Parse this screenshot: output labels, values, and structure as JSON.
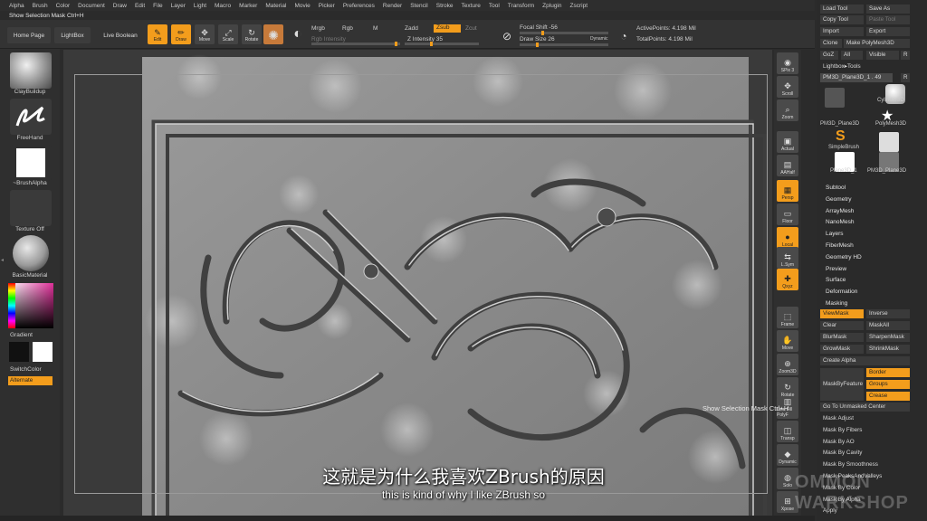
{
  "menu": [
    "Alpha",
    "Brush",
    "Color",
    "Document",
    "Draw",
    "Edit",
    "File",
    "Layer",
    "Light",
    "Macro",
    "Marker",
    "Material",
    "Movie",
    "Picker",
    "Preferences",
    "Render",
    "Stencil",
    "Stroke",
    "Texture",
    "Tool",
    "Transform",
    "Zplugin",
    "Zscript"
  ],
  "notice": "Show Selection Mask Ctrl+H",
  "toolbar": {
    "home_page": "Home Page",
    "lightbox": "LightBox",
    "live_boolean": "Live Boolean",
    "edit": "Edit",
    "draw": "Draw",
    "move": "Move",
    "scale": "Scale",
    "rotate": "Rotate",
    "mrgb": "Mrgb",
    "rgb": "Rgb",
    "m": "M",
    "rgb_intensity": "Rgb Intensity",
    "zadd": "Zadd",
    "zsub": "Zsub",
    "zcut": "Zcut",
    "z_intensity": "Z Intensity 35",
    "focal_shift": "Focal Shift -56",
    "draw_size": "Draw Size 26",
    "dynamic": "Dynamic",
    "active_points": "ActivePoints: 4.198 Mil",
    "total_points": "TotalPoints: 4.198 Mil"
  },
  "left_shelf": {
    "brush": "ClayBuildup",
    "stroke": "FreeHand",
    "alpha": "~BrushAlpha",
    "texture": "Texture Off",
    "material": "BasicMaterial",
    "gradient": "Gradient",
    "switch_color": "SwitchColor",
    "alternate": "Alternate"
  },
  "right_icons": [
    {
      "name": "spix",
      "label": "SPix 3",
      "glyph": "◉"
    },
    {
      "name": "scroll",
      "label": "Scroll",
      "glyph": "✥"
    },
    {
      "name": "zoom",
      "label": "Zoom",
      "glyph": "⌕"
    },
    {
      "name": "actual",
      "label": "Actual",
      "glyph": "▣"
    },
    {
      "name": "aahalf",
      "label": "AAHalf",
      "glyph": "▤"
    },
    {
      "name": "persp",
      "label": "Persp",
      "glyph": "▦"
    },
    {
      "name": "floor",
      "label": "Floor",
      "glyph": "▭"
    },
    {
      "name": "local",
      "label": "Local",
      "glyph": "●"
    },
    {
      "name": "lsym",
      "label": "L.Sym",
      "glyph": "⇆"
    },
    {
      "name": "qxyz",
      "label": "Qxyz",
      "glyph": "✚"
    },
    {
      "name": "frame",
      "label": "Frame",
      "glyph": "⬚"
    },
    {
      "name": "move",
      "label": "Move",
      "glyph": "✋"
    },
    {
      "name": "zoom3d",
      "label": "Zoom3D",
      "glyph": "⊕"
    },
    {
      "name": "rotate",
      "label": "Rotate",
      "glyph": "↻"
    },
    {
      "name": "linefill",
      "label": "Line Fill PolyF",
      "glyph": "▥"
    },
    {
      "name": "transp",
      "label": "Transp",
      "glyph": "◫"
    },
    {
      "name": "dynamic",
      "label": "Dynamic",
      "glyph": "◆"
    },
    {
      "name": "solo",
      "label": "Solo",
      "glyph": "◍"
    },
    {
      "name": "xpose",
      "label": "Xpose",
      "glyph": "⊞"
    }
  ],
  "panel": {
    "load_tool": "Load Tool",
    "save_as": "Save As",
    "copy_tool": "Copy Tool",
    "paste_tool": "Paste Tool",
    "import": "Import",
    "export": "Export",
    "clone": "Clone",
    "make_polymesh": "Make PolyMesh3D",
    "goz": "GoZ",
    "all": "All",
    "visible": "Visible",
    "r": "R",
    "lightbox_tools": "Lightbox▸Tools",
    "current_tool": "PM3D_Plane3D_1",
    "current_tool_value": "49",
    "thumbs": [
      "PM3D_Plane3D",
      "Cylinder3D",
      "SimpleBrush",
      "PolyMesh3D",
      "Plane3D_1",
      "PM3D_Plane3D"
    ],
    "subpalettes": [
      "Subtool",
      "Geometry",
      "ArrayMesh",
      "NanoMesh",
      "Layers",
      "FiberMesh",
      "Geometry HD",
      "Preview",
      "Surface",
      "Deformation",
      "Masking"
    ],
    "view_mask": "ViewMask",
    "inverse": "Inverse",
    "clear": "Clear",
    "mask_all": "MaskAll",
    "blur_mask": "BlurMask",
    "sharpen_mask": "SharpenMask",
    "grow_mask": "GrowMask",
    "shrink_mask": "ShrinkMask",
    "create_alpha": "Create Alpha",
    "mask_by_feature": "MaskByFeature",
    "border": "Border",
    "groups": "Groups",
    "crease": "Crease",
    "go_to_unmasked": "Go To Unmasked Center",
    "mask_items": [
      "Mask Adjust",
      "Mask By Fibers",
      "Mask By AO",
      "Mask By Cavity",
      "Mask By Smoothness",
      "Mask PeaksAndValleys",
      "Mask By Color",
      "Mask By Alpha"
    ],
    "apply": "Apply"
  },
  "tooltip": "Show Selection Mask  Ctrl+H",
  "subtitle_cn": "这就是为什么我喜欢ZBrush的原因",
  "subtitle_en": "this is kind of why I like ZBrush so",
  "watermark_top": "OMMON",
  "watermark_bottom": "WARKSHOP"
}
